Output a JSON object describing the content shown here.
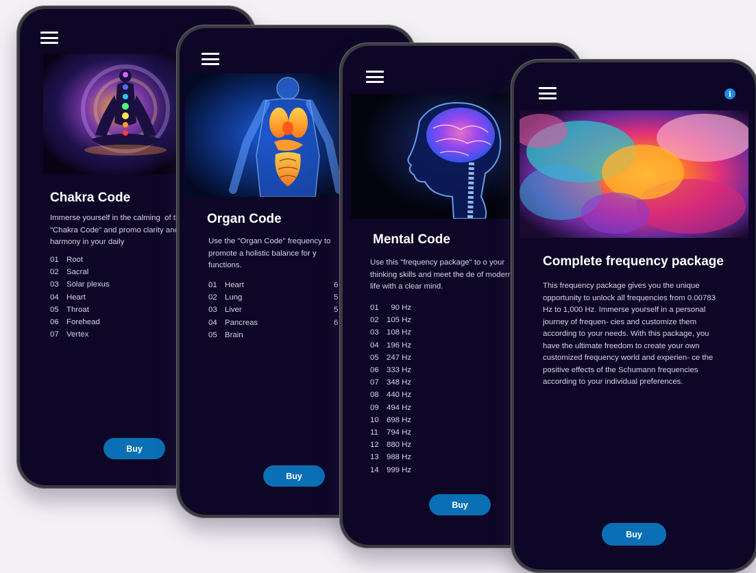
{
  "phones": [
    {
      "title": "Chakra Code",
      "description": "Immerse yourself in the calming  of the \"Chakra Code\" and promo clarity and harmony in your daily",
      "items": [
        {
          "num": "01",
          "label": "Root"
        },
        {
          "num": "02",
          "label": "Sacral"
        },
        {
          "num": "03",
          "label": "Solar plexus"
        },
        {
          "num": "04",
          "label": "Heart"
        },
        {
          "num": "05",
          "label": "Throat"
        },
        {
          "num": "06",
          "label": "Forehead"
        },
        {
          "num": "07",
          "label": "Vertex"
        }
      ],
      "buy_label": "Buy"
    },
    {
      "title": "Organ Code",
      "description": "Use the \"Organ Code\" frequency to promote a holistic balance for y functions.",
      "items": [
        {
          "num": "01",
          "label": "Heart"
        },
        {
          "num": "02",
          "label": "Lung"
        },
        {
          "num": "03",
          "label": "Liver"
        },
        {
          "num": "04",
          "label": "Pancreas"
        },
        {
          "num": "05",
          "label": "Brain"
        }
      ],
      "items_col2": [
        "6",
        "5",
        "5",
        "6"
      ],
      "buy_label": "Buy"
    },
    {
      "title": "Mental Code",
      "description": "Use this \"frequency package\" to o your thinking skills and meet the de of modern life with a clear mind.",
      "items": [
        {
          "num": "01",
          "label": "  90 Hz"
        },
        {
          "num": "02",
          "label": "105 Hz"
        },
        {
          "num": "03",
          "label": "108 Hz"
        },
        {
          "num": "04",
          "label": "196 Hz"
        },
        {
          "num": "05",
          "label": "247 Hz"
        },
        {
          "num": "06",
          "label": "333 Hz"
        },
        {
          "num": "07",
          "label": "348 Hz"
        },
        {
          "num": "08",
          "label": "440 Hz"
        },
        {
          "num": "09",
          "label": "494 Hz"
        },
        {
          "num": "10",
          "label": "698 Hz"
        },
        {
          "num": "11",
          "label": "794 Hz"
        },
        {
          "num": "12",
          "label": "880 Hz"
        },
        {
          "num": "13",
          "label": "988 Hz"
        },
        {
          "num": "14",
          "label": "999 Hz"
        }
      ],
      "buy_label": "Buy"
    },
    {
      "title": "Complete frequency package",
      "description": "This frequency package gives you the unique opportunity to unlock all frequencies from 0.00783 Hz to 1,000 Hz. Immerse yourself in a personal journey of frequen- cies and customize them according to your needs. With this package, you have the ultimate freedom to create your own customized frequency world and experien- ce the positive effects of the Schumann frequencies according to your individual preferences.",
      "buy_label": "Buy",
      "info_glyph": "i"
    }
  ],
  "colors": {
    "screen_bg": "#0d0626",
    "buy_button": "#0a6fb5",
    "info_badge": "#1e88e5"
  }
}
